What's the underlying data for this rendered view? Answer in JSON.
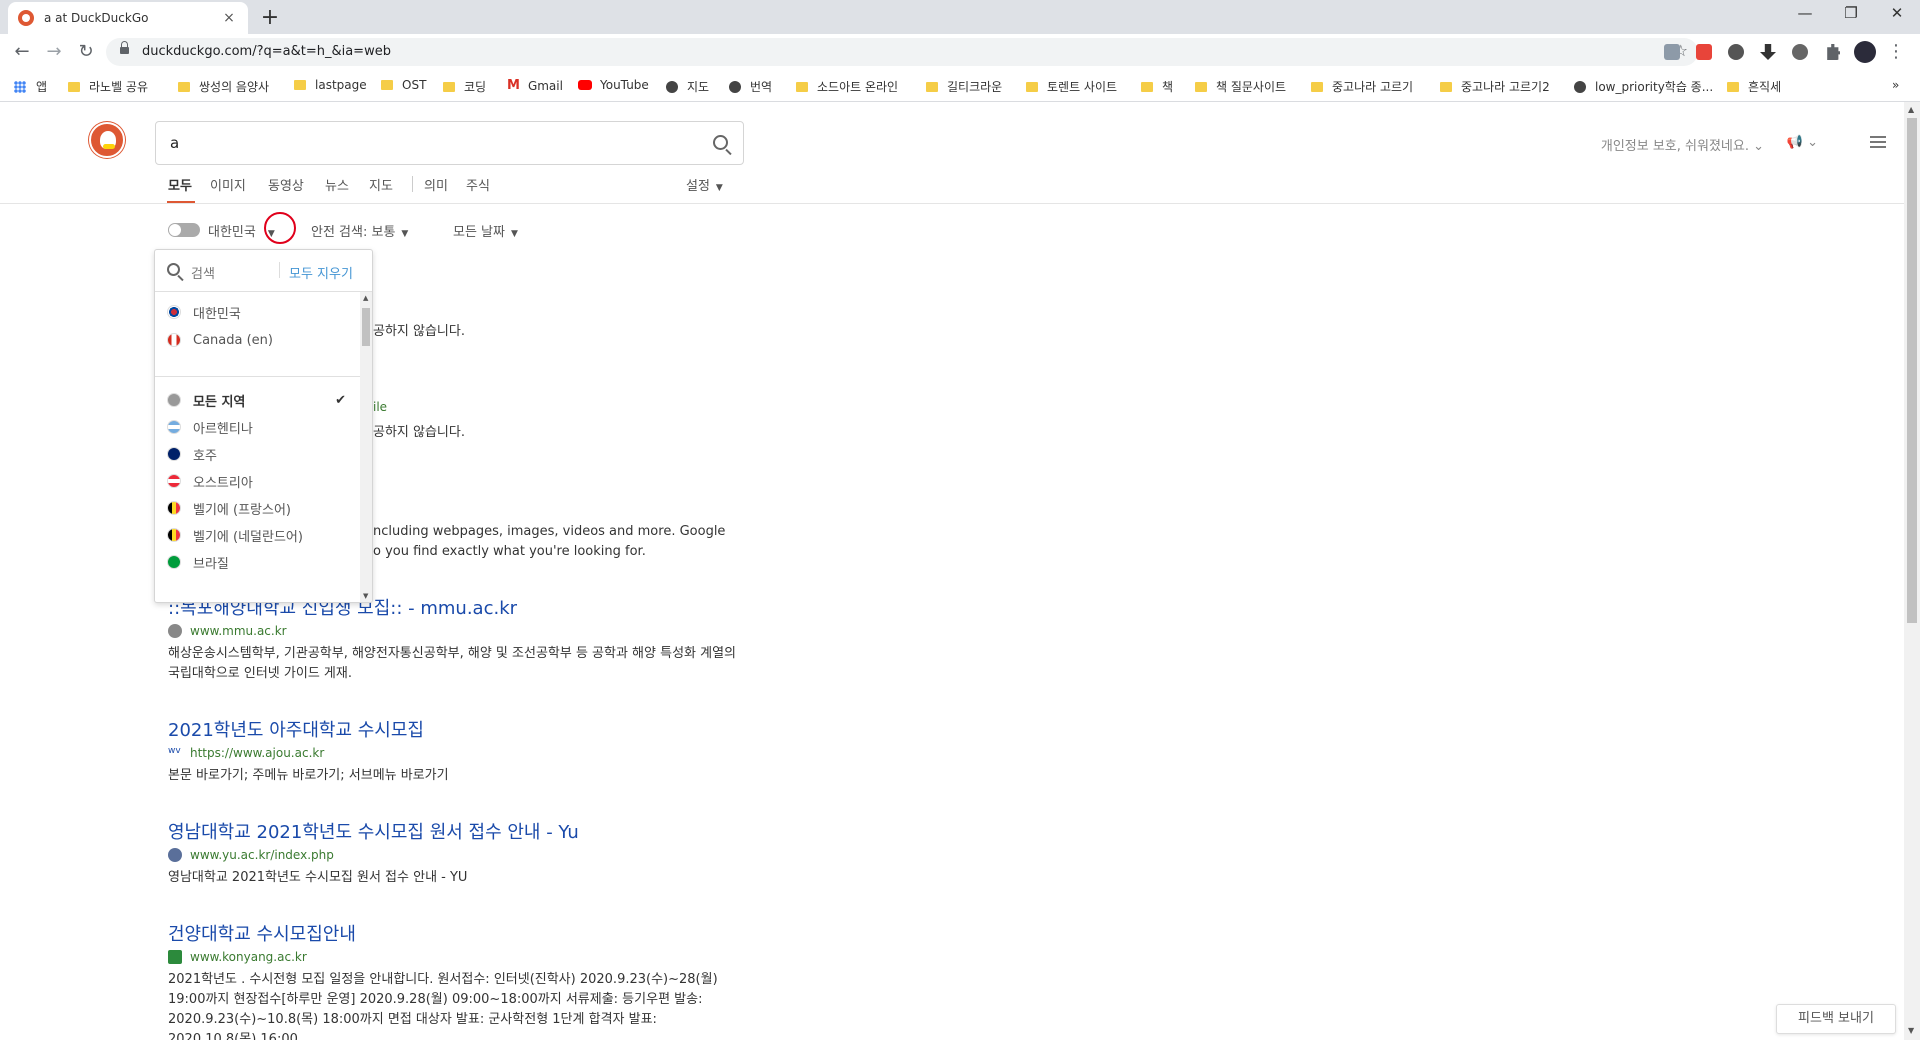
{
  "browser": {
    "tab_title": "a at DuckDuckGo",
    "tab_close": "×",
    "new_tab": "+",
    "url": "duckduckgo.com/?q=a&t=h_&ia=web",
    "window": {
      "minimize": "—",
      "restore": "❐",
      "close": "✕"
    },
    "nav": {
      "back": "←",
      "forward": "→",
      "reload": "↻",
      "star": "☆",
      "menu": "⋮"
    }
  },
  "bookmarks": {
    "items": [
      "앱",
      "라노벨 공유",
      "쌍성의 음양사",
      "lastpage",
      "OST",
      "코딩",
      "Gmail",
      "YouTube",
      "지도",
      "번역",
      "소드아트 온라인",
      "길티크라운",
      "토렌트 사이트",
      "책",
      "책 질문사이트",
      "중고나라 고르기",
      "중고나라 고르기2",
      "low_priority학습 종...",
      "흔직세"
    ],
    "gmail_mark": "M",
    "overflow": "»"
  },
  "ddg": {
    "query": "a",
    "privacy_text": "개인정보 보호, 쉬워졌네요.",
    "megaphone": "📢 ⌄",
    "tabs": [
      "모두",
      "이미지",
      "동영상",
      "뉴스",
      "지도",
      "의미",
      "주식"
    ],
    "settings": "설정",
    "filters": {
      "region": "대한민국",
      "safe_search": "안전 검색: 보통",
      "date": "모든 날짜"
    },
    "caret": "▼"
  },
  "region_dropdown": {
    "search_placeholder": "검색",
    "clear_all": "모두 지우기",
    "recent": [
      "대한민국",
      "Canada (en)"
    ],
    "regions": [
      "모든 지역",
      "아르헨티나",
      "호주",
      "오스트리아",
      "벨기에 (프랑스어)",
      "벨기에 (네덜란드어)",
      "브라질"
    ],
    "check": "✔",
    "scroll_up": "▲",
    "scroll_down": "▼"
  },
  "hidden_partials": {
    "p1": "공하지 않습니다.",
    "p2": "ile",
    "p3": "공하지 않습니다.",
    "p4": "ncluding webpages, images, videos and more. Google",
    "p5": "o you find exactly what you're looking for."
  },
  "results": [
    {
      "title": "::목포해양대학교 신입생 모집:: - mmu.ac.kr",
      "url": "www.mmu.ac.kr",
      "snippet": "해상운송시스템학부, 기관공학부, 해양전자통신공학부, 해양 및 조선공학부 등 공학과 해양 특성화 계열의 국립대학으로 인터넷 가이드 게재."
    },
    {
      "title": "2021학년도 아주대학교 수시모집",
      "url": "https://www.ajou.ac.kr",
      "favicon_text": "wv",
      "snippet": "본문 바로가기; 주메뉴 바로가기; 서브메뉴 바로가기"
    },
    {
      "title": "영남대학교 2021학년도 수시모집 원서 접수 안내 - Yu",
      "url": "www.yu.ac.kr/index.php",
      "snippet": "영남대학교 2021학년도 수시모집 원서 접수 안내 - YU"
    },
    {
      "title": "건양대학교 수시모집안내",
      "url": "www.konyang.ac.kr",
      "snippet": "2021학년도 . 수시전형 모집 일정을 안내합니다. 원서접수: 인터넷(진학사) 2020.9.23(수)~28(월) 19:00까지 현장접수[하루만 운영] 2020.9.28(월) 09:00~18:00까지 서류제출: 등기우편 발송: 2020.9.23(수)~10.8(목) 18:00까지 면접 대상자 발표: 군사학전형 1단계 합격자 발표: 2020.10.8(목) 16:00"
    }
  ],
  "feedback": "피드백 보내기",
  "page_scroll": {
    "up": "▲",
    "down": "▼"
  }
}
